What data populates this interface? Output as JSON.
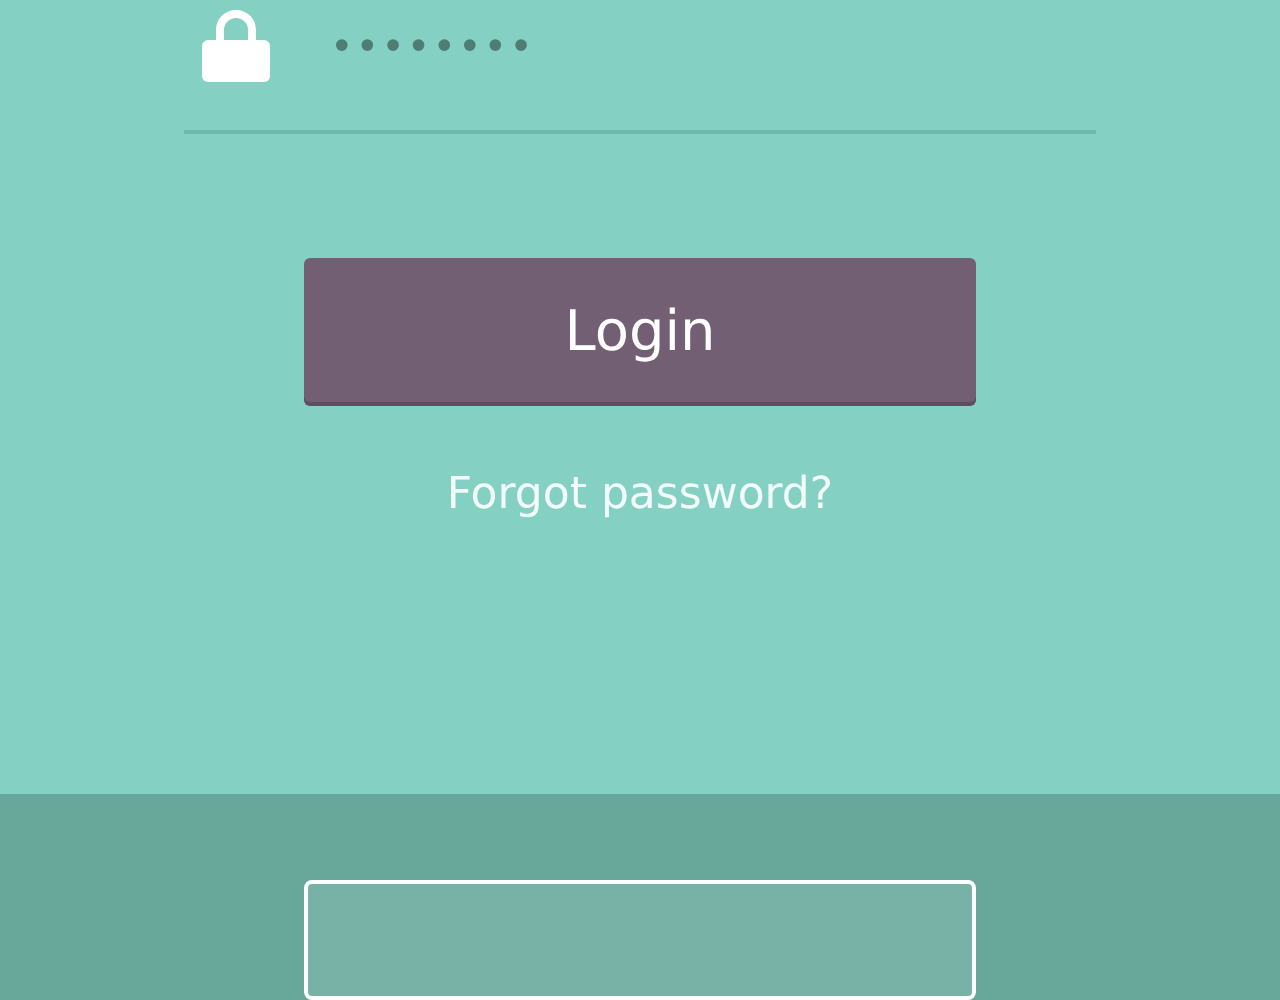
{
  "password_field": {
    "value": "••••••••"
  },
  "login_button": {
    "label": "Login"
  },
  "forgot_link": {
    "label": "Forgot password?"
  },
  "secondary_button": {
    "kind": "outline"
  }
}
